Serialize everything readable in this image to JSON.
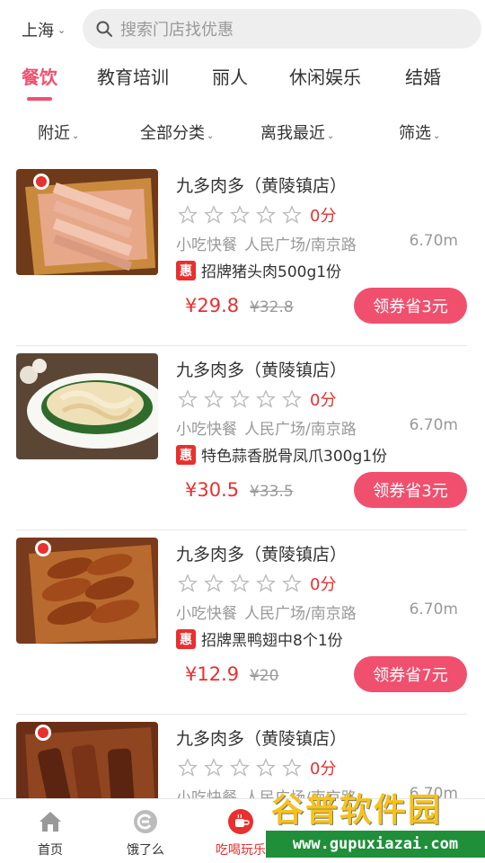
{
  "header": {
    "city": "上海",
    "search_placeholder": "搜索门店找优惠"
  },
  "tabs": [
    {
      "label": "餐饮",
      "active": true
    },
    {
      "label": "教育培训",
      "active": false
    },
    {
      "label": "丽人",
      "active": false
    },
    {
      "label": "休闲娱乐",
      "active": false
    },
    {
      "label": "结婚",
      "active": false
    }
  ],
  "filters": [
    "附近",
    "全部分类",
    "离我最近",
    "筛选"
  ],
  "items": [
    {
      "title": "九多肉多（黄陵镇店）",
      "rating_stars": 0,
      "score": "0分",
      "category": "小吃快餐",
      "area": "人民广场/南京路",
      "distance": "6.70m",
      "deal_badge": "惠",
      "deal": "招牌猪头肉500g1份",
      "price": "¥29.8",
      "original_price": "¥32.8",
      "coupon": "领券省3元",
      "image": "sliced-pork-head"
    },
    {
      "title": "九多肉多（黄陵镇店）",
      "rating_stars": 0,
      "score": "0分",
      "category": "小吃快餐",
      "area": "人民广场/南京路",
      "distance": "6.70m",
      "deal_badge": "惠",
      "deal": "特色蒜香脱骨凤爪300g1份",
      "price": "¥30.5",
      "original_price": "¥33.5",
      "coupon": "领券省3元",
      "image": "garlic-chicken-feet"
    },
    {
      "title": "九多肉多（黄陵镇店）",
      "rating_stars": 0,
      "score": "0分",
      "category": "小吃快餐",
      "area": "人民广场/南京路",
      "distance": "6.70m",
      "deal_badge": "惠",
      "deal": "招牌黑鸭翅中8个1份",
      "price": "¥12.9",
      "original_price": "¥20",
      "coupon": "领券省7元",
      "image": "duck-wings"
    },
    {
      "title": "九多肉多（黄陵镇店）",
      "rating_stars": 0,
      "score": "0分",
      "category": "小吃快餐",
      "area": "人民广场/南京路",
      "distance": "6.70m",
      "image": "braised-ribs"
    }
  ],
  "bottom_nav": [
    {
      "label": "首页",
      "icon": "home-icon",
      "active": false
    },
    {
      "label": "饿了么",
      "icon": "eleme-icon",
      "active": false
    },
    {
      "label": "吃喝玩乐",
      "icon": "cup-icon",
      "active": true
    }
  ],
  "watermark": {
    "title": "谷普软件园",
    "url": "www.gupuxiazai.com"
  },
  "colors": {
    "accent": "#f0506e",
    "price_red": "#e8302f",
    "muted": "#999999"
  }
}
